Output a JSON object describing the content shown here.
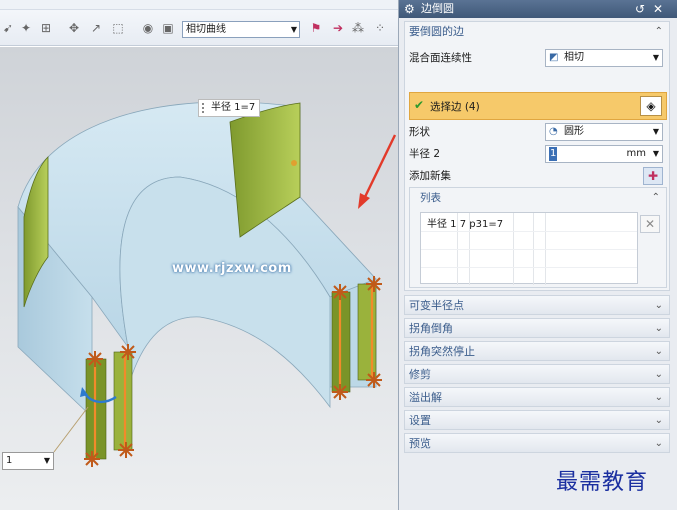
{
  "toolbar": {
    "curve_rule": "相切曲线",
    "icons": [
      "curve-tool-icon",
      "snap-point-icon",
      "select-filter-icon",
      "move-icon",
      "box-select-icon",
      "shade-icon",
      "cube-view-icon",
      "vector-icon",
      "arrow-icon",
      "grid-icon"
    ]
  },
  "viewport": {
    "radius_callout": "半径 1=7",
    "watermark": "www.rjzxw.com",
    "small_dropdown": "1"
  },
  "dialog": {
    "title": "边倒圆",
    "groups": {
      "edge": {
        "title": "要倒圆的边",
        "blend_continuity_label": "混合面连续性",
        "blend_continuity_value": "相切",
        "select_edge_label": "选择边 (4)",
        "shape_label": "形状",
        "shape_value": "圆形",
        "radius_label": "半径 2",
        "radius_value": "1",
        "radius_unit": "mm",
        "add_set_label": "添加新集",
        "list": {
          "title": "列表",
          "rows": [
            "半径 1  7  p31=7"
          ]
        }
      }
    },
    "collapsed_groups": [
      "可变半径点",
      "拐角倒角",
      "拐角突然停止",
      "修剪",
      "溢出解",
      "设置",
      "预览"
    ]
  },
  "logo": "最需教育",
  "colors": {
    "accent": "#3b5d8c",
    "selection": "#f6c96a",
    "edge_marker": "#c05a1a",
    "face_green": "#a8c04a"
  }
}
